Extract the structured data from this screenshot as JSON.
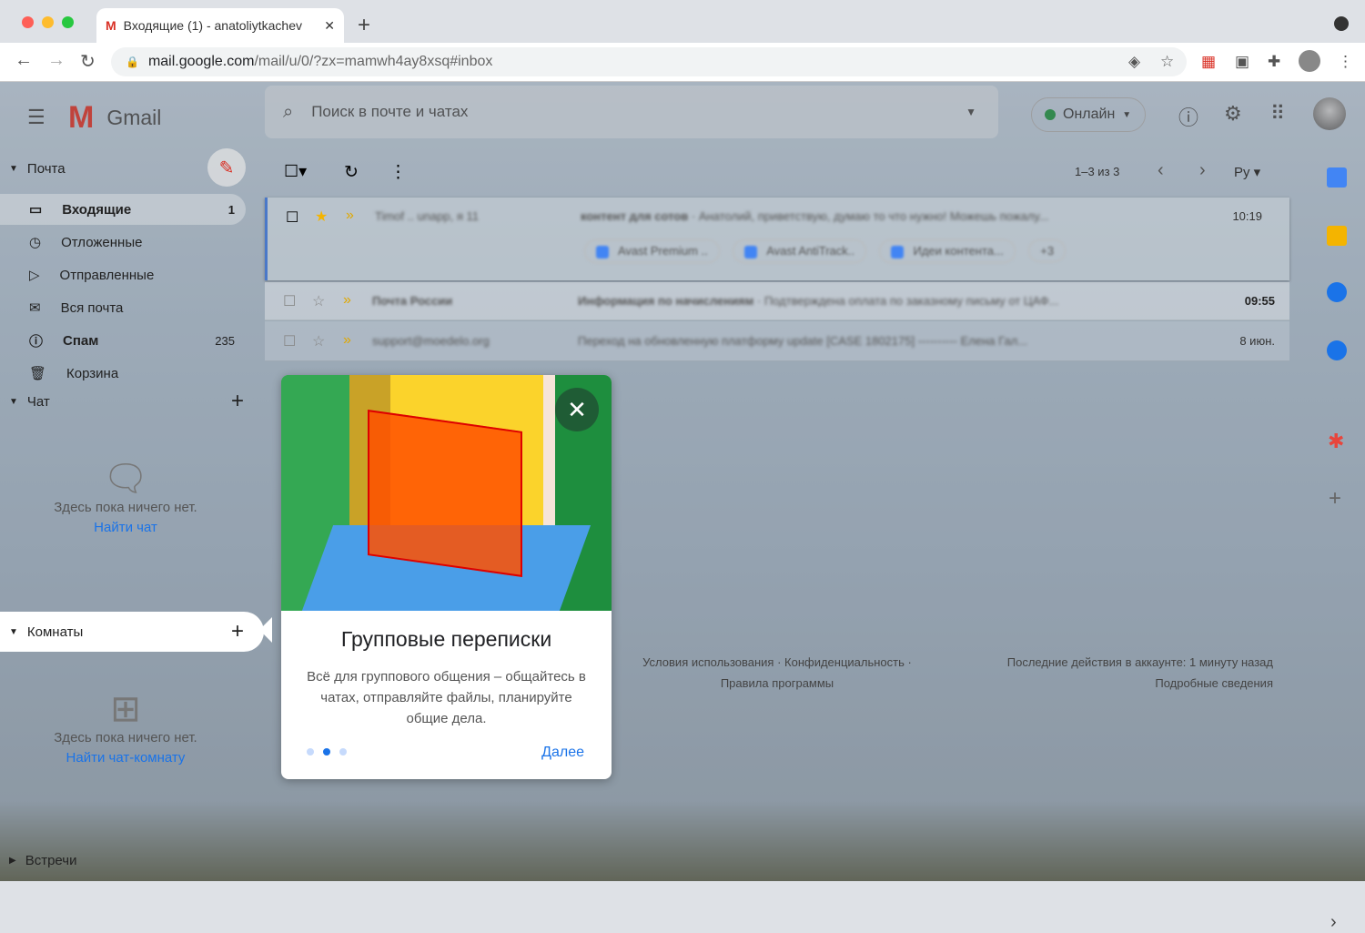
{
  "browser": {
    "tab_title": "Входящие (1) - anatoliytkachev",
    "url_host": "mail.google.com",
    "url_path": "/mail/u/0/?zx=mamwh4ay8xsq#inbox"
  },
  "header": {
    "app_name": "Gmail",
    "search_placeholder": "Поиск в почте и чатах",
    "status": "Онлайн"
  },
  "sidebar": {
    "mail_section": "Почта",
    "items": [
      {
        "label": "Входящие",
        "count": "1",
        "icon": "inbox-icon"
      },
      {
        "label": "Отложенные",
        "count": "",
        "icon": "clock-icon"
      },
      {
        "label": "Отправленные",
        "count": "",
        "icon": "send-icon"
      },
      {
        "label": "Вся почта",
        "count": "",
        "icon": "mail-icon"
      },
      {
        "label": "Спам",
        "count": "235",
        "icon": "spam-icon"
      },
      {
        "label": "Корзина",
        "count": "",
        "icon": "trash-icon"
      }
    ],
    "chat_section": "Чат",
    "chat_empty": "Здесь пока ничего нет.",
    "chat_find": "Найти чат",
    "rooms_section": "Комнаты",
    "rooms_empty": "Здесь пока ничего нет.",
    "rooms_find": "Найти чат-комнату",
    "meet_section": "Встречи"
  },
  "list": {
    "pagination": "1–3 из 3",
    "lang": "Ру",
    "emails": [
      {
        "sender": "Timof .. unapp, я 11",
        "subject": "контент для сотов",
        "snippet": "Анатолий, приветствую, думаю то что нужно! Можешь пожалу...",
        "time": "10:19",
        "starred": true,
        "unread": false,
        "attachments": [
          "Avast Premium ..",
          "Avast AntiTrack..",
          "Идеи контента..."
        ],
        "more": "+3"
      },
      {
        "sender": "Почта России",
        "subject": "Информация по начислениям",
        "snippet": "Подтверждена оплата по заказному письму от ЦАФ...",
        "time": "09:55",
        "starred": false,
        "unread": true
      },
      {
        "sender": "support@moedelo.org",
        "subject": "Переход на обновленную платформу update [CASE 1802175]",
        "snippet": "---------- Елена Гал...",
        "time": "8 июн.",
        "starred": false,
        "unread": false
      }
    ]
  },
  "footer": {
    "terms": "Условия использования · Конфиденциальность ·",
    "policy": "Правила программы",
    "activity": "Последние действия в аккаунте: 1 минуту назад",
    "details": "Подробные сведения"
  },
  "popup": {
    "title": "Групповые переписки",
    "text": "Всё для группового общения – общайтесь в чатах, отправляйте файлы, планируйте общие дела.",
    "next": "Далее",
    "step": 2,
    "total_steps": 3
  },
  "colors": {
    "accent": "#1a73e8",
    "star": "#f4b400",
    "online": "#1e8e3e"
  }
}
